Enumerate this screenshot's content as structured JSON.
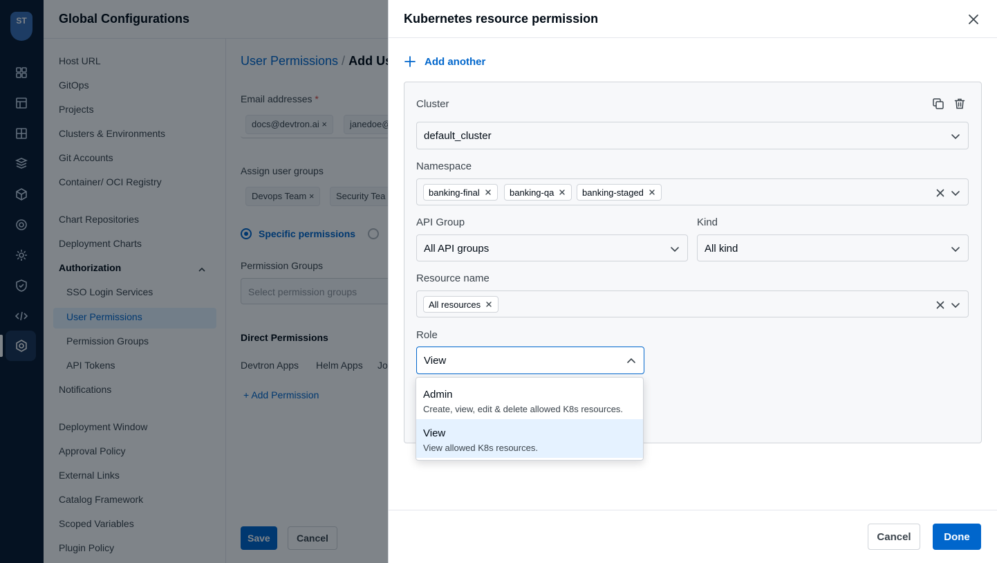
{
  "rail": {
    "logo_text": "ST",
    "icons": [
      "apps-grid-icon",
      "chart-icon",
      "resource-browser-icon",
      "security-icon",
      "cube-icon",
      "chart-store-icon",
      "gear-icon",
      "shield-icon",
      "code-icon",
      "settings-icon"
    ]
  },
  "global_config": {
    "title": "Global Configurations",
    "nav": {
      "host_url": "Host URL",
      "gitops": "GitOps",
      "projects": "Projects",
      "clusters": "Clusters & Environments",
      "git_accounts": "Git Accounts",
      "registry": "Container/ OCI Registry",
      "chart_repositories": "Chart Repositories",
      "deployment_charts": "Deployment Charts",
      "authorization": "Authorization",
      "sso": "SSO Login Services",
      "user_permissions": "User Permissions",
      "permission_groups": "Permission Groups",
      "api_tokens": "API Tokens",
      "notifications": "Notifications",
      "deployment_window": "Deployment Window",
      "approval_policy": "Approval Policy",
      "external_links": "External Links",
      "catalog_framework": "Catalog Framework",
      "scoped_variables": "Scoped Variables",
      "plugin_policy": "Plugin Policy"
    }
  },
  "main": {
    "breadcrumb": {
      "parent": "User Permissions",
      "separator": "/",
      "current": "Add Us"
    },
    "email_label": "Email addresses",
    "required_mark": "*",
    "emails": [
      "docs@devtron.ai",
      "janedoe@"
    ],
    "groups_label": "Assign user groups",
    "groups": [
      "Devops Team",
      "Security Tea"
    ],
    "specific_permissions": "Specific permissions",
    "permission_groups_label": "Permission Groups",
    "permission_groups_placeholder": "Select permission groups",
    "direct_permissions": "Direct Permissions",
    "tabs": [
      "Devtron Apps",
      "Helm Apps",
      "Jo"
    ],
    "add_permission": "Add Permission",
    "save": "Save",
    "cancel": "Cancel"
  },
  "drawer": {
    "title": "Kubernetes resource permission",
    "add_another": "Add another",
    "cluster": {
      "label": "Cluster",
      "value": "default_cluster"
    },
    "namespace": {
      "label": "Namespace",
      "values": [
        "banking-final",
        "banking-qa",
        "banking-staged"
      ]
    },
    "api_group": {
      "label": "API Group",
      "value": "All API groups"
    },
    "kind": {
      "label": "Kind",
      "value": "All kind"
    },
    "resource_name": {
      "label": "Resource name",
      "values": [
        "All resources"
      ]
    },
    "role": {
      "label": "Role",
      "value": "View",
      "options": [
        {
          "label": "Admin",
          "description": "Create, view, edit & delete allowed K8s resources."
        },
        {
          "label": "View",
          "description": "View allowed K8s resources."
        }
      ]
    },
    "footer": {
      "cancel": "Cancel",
      "done": "Done"
    }
  },
  "colors": {
    "accent": "#0066cc",
    "nav_rail": "#0b1b30",
    "selected_option": "#e5f2ff"
  }
}
